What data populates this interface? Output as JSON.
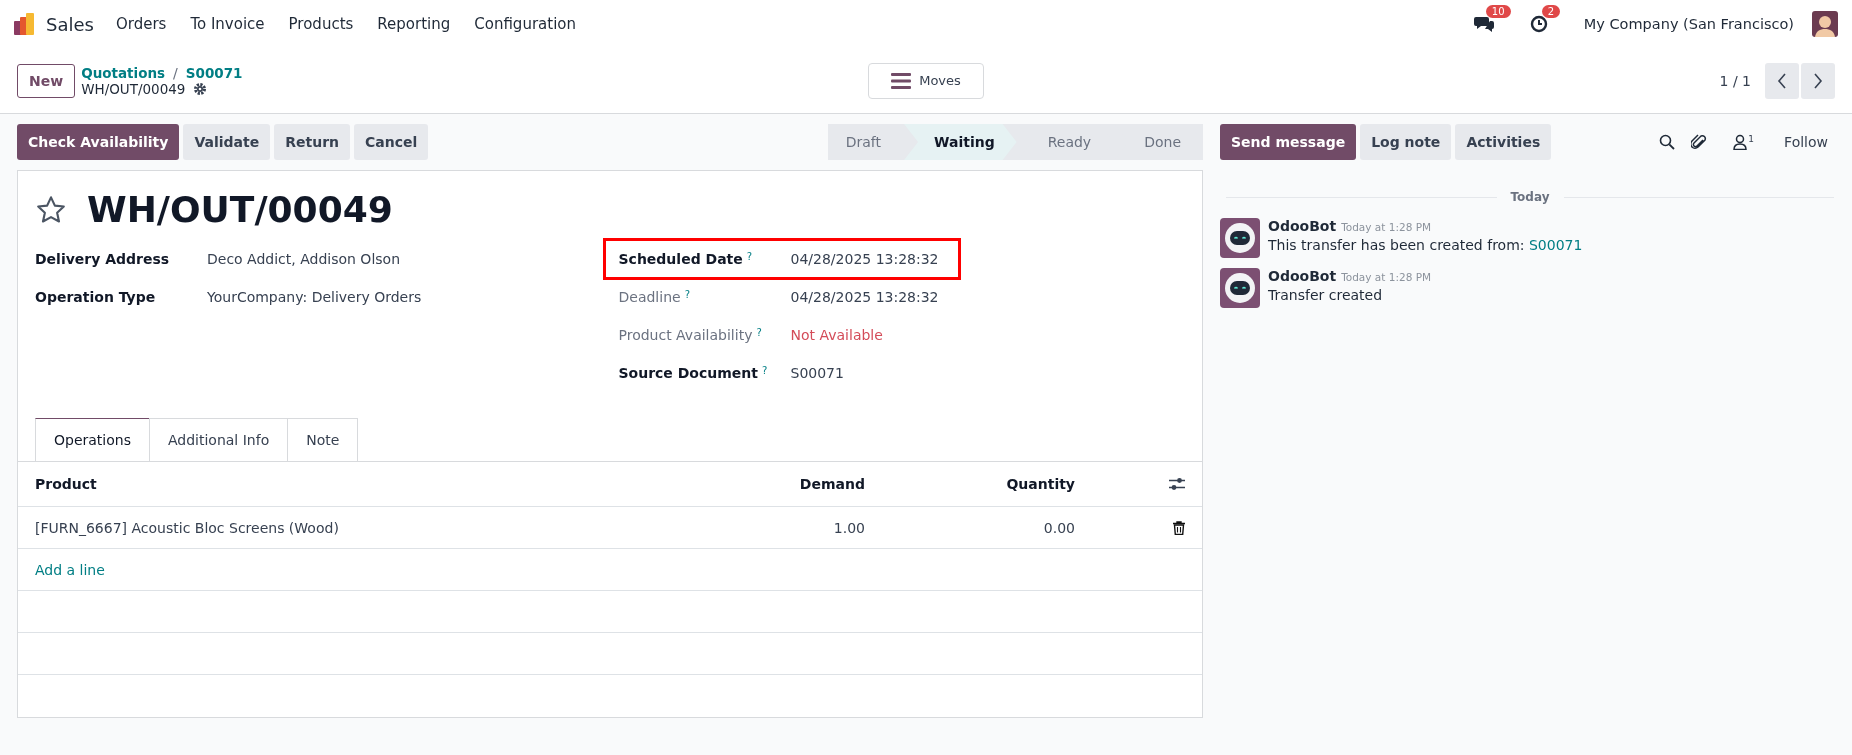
{
  "app": {
    "name": "Sales",
    "menu": [
      "Orders",
      "To Invoice",
      "Products",
      "Reporting",
      "Configuration"
    ]
  },
  "systray": {
    "messages_count": "10",
    "activities_count": "2",
    "company": "My Company (San Francisco)"
  },
  "control_panel": {
    "new_button": "New",
    "breadcrumbs": [
      "Quotations",
      "S00071"
    ],
    "breadcrumb_separator": "/",
    "record_name": "WH/OUT/00049",
    "moves_button": "Moves",
    "pager": "1 / 1"
  },
  "actions": [
    {
      "label": "Check Availability",
      "primary": true
    },
    {
      "label": "Validate",
      "primary": false
    },
    {
      "label": "Return",
      "primary": false
    },
    {
      "label": "Cancel",
      "primary": false
    }
  ],
  "statusbar": [
    {
      "label": "Draft",
      "selected": false
    },
    {
      "label": "Waiting",
      "selected": true
    },
    {
      "label": "Ready",
      "selected": false
    },
    {
      "label": "Done",
      "selected": false
    }
  ],
  "record": {
    "favorite": false,
    "title": "WH/OUT/00049",
    "fields_left": [
      {
        "label": "Delivery Address",
        "value": "Deco Addict, Addison Olson",
        "emphasized": true,
        "danger": false
      },
      {
        "label": "Operation Type",
        "value": "YourCompany: Delivery Orders",
        "emphasized": true,
        "danger": false
      }
    ],
    "fields_right": [
      {
        "label": "Scheduled Date",
        "help": "?",
        "value": "04/28/2025 13:28:32",
        "emphasized": true,
        "highlighted": true,
        "danger": false
      },
      {
        "label": "Deadline",
        "help": "?",
        "value": "04/28/2025 13:28:32",
        "emphasized": false,
        "highlighted": false,
        "danger": false
      },
      {
        "label": "Product Availability",
        "help": "?",
        "value": "Not Available",
        "emphasized": false,
        "highlighted": false,
        "danger": true
      },
      {
        "label": "Source Document",
        "help": "?",
        "value": "S00071",
        "emphasized": true,
        "highlighted": false,
        "danger": false
      }
    ]
  },
  "tabs": [
    {
      "label": "Operations",
      "selected": true
    },
    {
      "label": "Additional Info",
      "selected": false
    },
    {
      "label": "Note",
      "selected": false
    }
  ],
  "table": {
    "columns": [
      "Product",
      "Demand",
      "Quantity"
    ],
    "rows": [
      {
        "product": "[FURN_6667] Acoustic Bloc Screens (Wood)",
        "demand": "1.00",
        "quantity": "0.00"
      }
    ],
    "add_line": "Add a line"
  },
  "chatter": {
    "buttons": [
      {
        "label": "Send message",
        "primary": true
      },
      {
        "label": "Log note",
        "primary": false
      },
      {
        "label": "Activities",
        "primary": false
      }
    ],
    "follower_count": "1",
    "follow": "Follow",
    "divider": "Today",
    "messages": [
      {
        "author": "OdooBot",
        "time": "Today at 1:28 PM",
        "text": "This transfer has been created from: ",
        "link": "S00071"
      },
      {
        "author": "OdooBot",
        "time": "Today at 1:28 PM",
        "text": "Transfer created"
      }
    ]
  }
}
